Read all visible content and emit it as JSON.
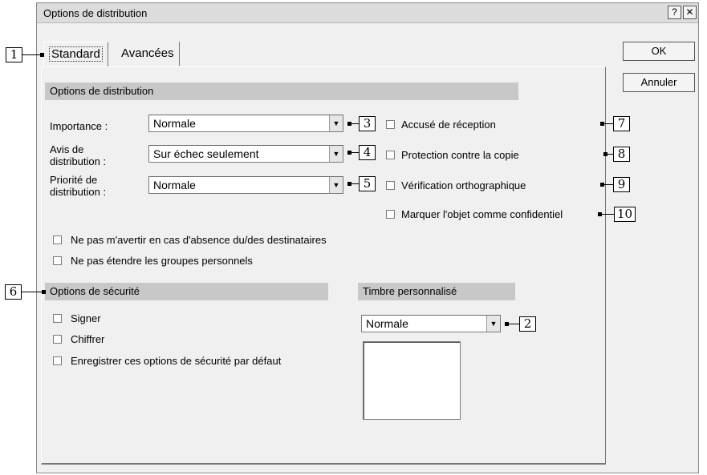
{
  "window": {
    "title": "Options de distribution",
    "help_label": "?",
    "close_label": "✕"
  },
  "tabs": [
    {
      "label": "Standard"
    },
    {
      "label": "Avancées"
    }
  ],
  "buttons": {
    "ok": "OK",
    "cancel": "Annuler"
  },
  "delivery_section": {
    "header": "Options de distribution",
    "importance": {
      "label": "Importance :",
      "value": "Normale"
    },
    "notification": {
      "label_line1": "Avis de",
      "label_line2": "distribution :",
      "value": "Sur échec seulement"
    },
    "priority": {
      "label_line1": "Priorité de",
      "label_line2": "distribution :",
      "value": "Normale"
    },
    "checkboxes": {
      "receipt": "Accusé de réception",
      "copy_protection": "Protection contre la copie",
      "spellcheck": "Vérification orthographique",
      "confidential": "Marquer l'objet comme confidentiel",
      "no_absence_notice": "Ne pas m'avertir en cas d'absence du/des destinataires",
      "no_expand_groups": "Ne pas étendre les groupes personnels"
    }
  },
  "security_section": {
    "header": "Options de sécurité",
    "sign": "Signer",
    "encrypt": "Chiffrer",
    "save_default": "Enregistrer ces options de sécurité par défaut"
  },
  "stamp_section": {
    "header": "Timbre personnalisé",
    "value": "Normale"
  },
  "callouts": {
    "c1": "1",
    "c2": "2",
    "c3": "3",
    "c4": "4",
    "c5": "5",
    "c6": "6",
    "c7": "7",
    "c8": "8",
    "c9": "9",
    "c10": "10"
  },
  "icons": {
    "dropdown": "▼"
  }
}
